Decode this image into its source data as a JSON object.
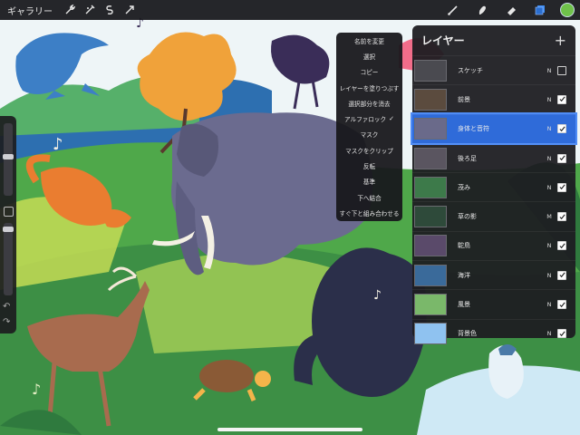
{
  "topbar": {
    "gallery_label": "ギャラリー",
    "left_tools": [
      "wrench-icon",
      "adjustments-icon",
      "selection-icon",
      "transform-icon"
    ],
    "right_tools": [
      "brush-icon",
      "smudge-icon",
      "eraser-icon",
      "layers-icon"
    ],
    "color_swatch": "#6fc24a"
  },
  "context_menu": {
    "items": [
      "名前を変更",
      "選択",
      "コピー",
      "レイヤーを塗りつぶす",
      "選択部分を消去",
      "アルファロック",
      "マスク",
      "マスクをクリップ",
      "反転",
      "基準",
      "下へ結合",
      "すぐ下と組み合わせる"
    ],
    "checkmark": "✓"
  },
  "layers_panel": {
    "title": "レイヤー",
    "add_label": "+",
    "layers": [
      {
        "name": "スケッチ",
        "mode": "N",
        "visible": false,
        "active": false,
        "thumb": "#4a4a50"
      },
      {
        "name": "前景",
        "mode": "N",
        "visible": true,
        "active": false,
        "thumb": "#5b4b3e"
      },
      {
        "name": "身体と音符",
        "mode": "N",
        "visible": true,
        "active": true,
        "thumb": "#6a6a8a"
      },
      {
        "name": "後ろ足",
        "mode": "N",
        "visible": true,
        "active": false,
        "thumb": "#5a5560"
      },
      {
        "name": "茂み",
        "mode": "N",
        "visible": true,
        "active": false,
        "thumb": "#3d7a4a"
      },
      {
        "name": "草の影",
        "mode": "M",
        "visible": true,
        "active": false,
        "thumb": "#2e4a3a"
      },
      {
        "name": "駝鳥",
        "mode": "N",
        "visible": true,
        "active": false,
        "thumb": "#5a4a6a"
      },
      {
        "name": "海洋",
        "mode": "N",
        "visible": true,
        "active": false,
        "thumb": "#3a6a9a"
      },
      {
        "name": "風景",
        "mode": "N",
        "visible": true,
        "active": false,
        "thumb": "#7ab86a"
      },
      {
        "name": "背景色",
        "mode": "N",
        "visible": true,
        "active": false,
        "thumb": "#8fc2f0"
      }
    ]
  },
  "colors": {
    "accent": "#2f6bd9",
    "sky": "#eaf3f8",
    "grass": "#4fa84a"
  }
}
